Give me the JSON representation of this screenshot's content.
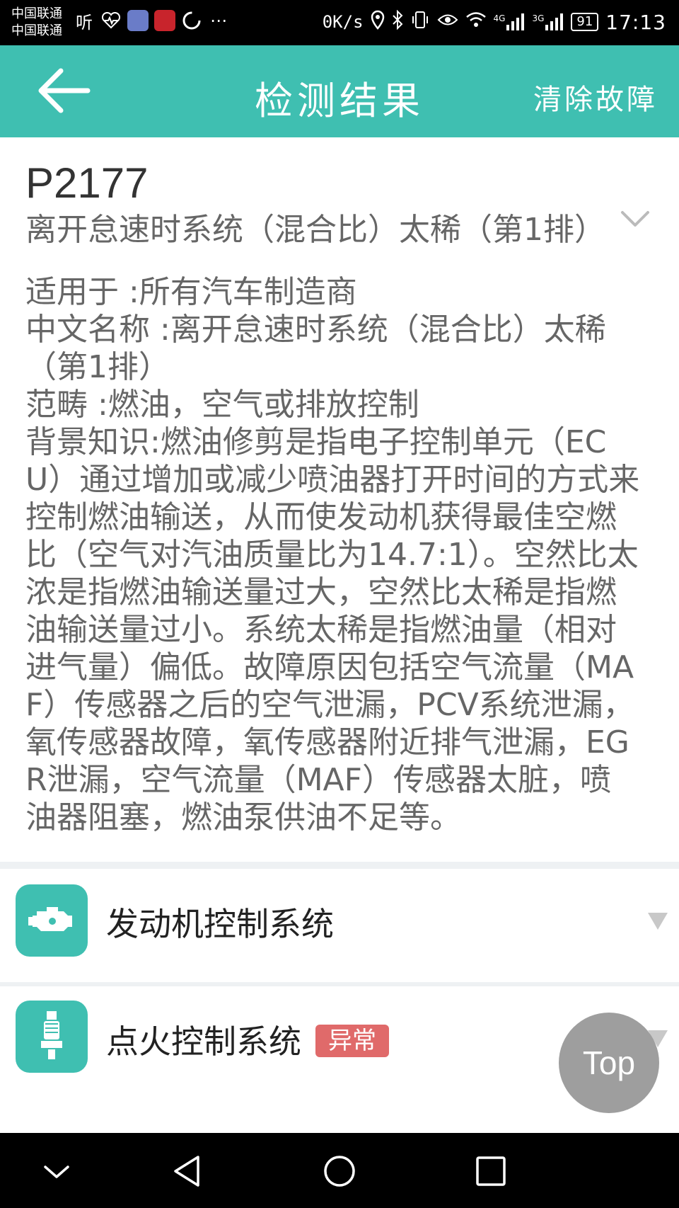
{
  "status_bar": {
    "carrier_1": "中国联通",
    "carrier_2": "中国联通",
    "network_speed": "0K/s",
    "signal_1": "4G",
    "signal_2": "3G",
    "battery": "91",
    "time": "17:13"
  },
  "header": {
    "title": "检测结果",
    "clear_label": "清除故障"
  },
  "fault": {
    "code": "P2177",
    "short_description": "离开怠速时系统（混合比）太稀（第1排）",
    "detail": "适用于 :所有汽车制造商\n中文名称 :离开怠速时系统（混合比）太稀（第1排）\n范畴 :燃油，空气或排放控制\n背景知识:燃油修剪是指电子控制单元（ECU）通过增加或减少喷油器打开时间的方式来控制燃油输送，从而使发动机获得最佳空燃比（空气对汽油质量比为14.7:1）。空然比太浓是指燃油输送量过大，空然比太稀是指燃油输送量过小。系统太稀是指燃油量（相对进气量）偏低。故障原因包括空气流量（MAF）传感器之后的空气泄漏，PCV系统泄漏，氧传感器故障，氧传感器附近排气泄漏，EGR泄漏，空气流量（MAF）传感器太脏，喷油器阻塞，燃油泵供油不足等。"
  },
  "systems": [
    {
      "label": "发动机控制系统",
      "icon": "engine-icon"
    },
    {
      "label": "点火控制系统",
      "icon": "spark-plug-icon",
      "badge": "异常"
    }
  ],
  "top_button": "Top",
  "colors": {
    "accent": "#3fbfb1",
    "badge": "#e06a6a"
  }
}
